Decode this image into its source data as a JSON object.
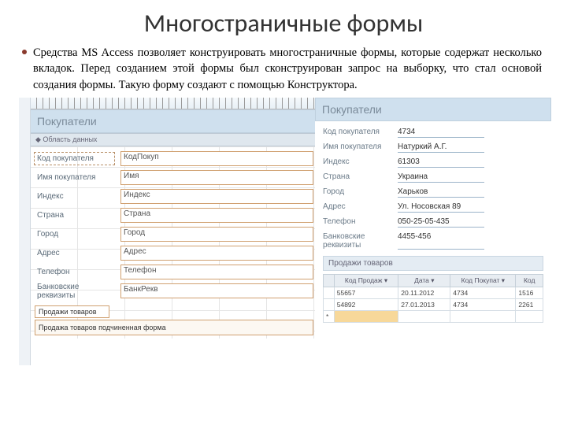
{
  "title": "Многостраничные формы",
  "bullet": "Средства MS Access позволяет конструировать многостраничные формы, которые содержат несколько вкладок. Перед созданием этой формы был сконструирован запрос на выборку, что стал основой создания формы. Такую форму создают с помощью Конструктора.",
  "left": {
    "header": "Покупатели",
    "section": "◆ Область данных",
    "rows": [
      {
        "lbl": "Код покупателя",
        "ctl": "КодПокуп"
      },
      {
        "lbl": "Имя покупателя",
        "ctl": "Имя"
      },
      {
        "lbl": "Индекс",
        "ctl": "Индекс"
      },
      {
        "lbl": "Страна",
        "ctl": "Страна"
      },
      {
        "lbl": "Город",
        "ctl": "Город"
      },
      {
        "lbl": "Адрес",
        "ctl": "Адрес"
      },
      {
        "lbl": "Телефон",
        "ctl": "Телефон"
      },
      {
        "lbl": "Банковские реквизиты",
        "ctl": "БанкРекв"
      }
    ],
    "sublbl": "Продажи товаров",
    "subtxt": "Продажа товаров подчиненная форма"
  },
  "right": {
    "header": "Покупатели",
    "rows": [
      {
        "lbl": "Код покупателя",
        "val": "4734"
      },
      {
        "lbl": "Имя покупателя",
        "val": "Натуркий А.Г."
      },
      {
        "lbl": "Индекс",
        "val": "61303"
      },
      {
        "lbl": "Страна",
        "val": "Украина"
      },
      {
        "lbl": "Город",
        "val": "Харьков"
      },
      {
        "lbl": "Адрес",
        "val": "Ул. Носовская 89"
      },
      {
        "lbl": "Телефон",
        "val": "050-25-05-435"
      },
      {
        "lbl": "Банковские реквизиты",
        "val": "4455-456"
      }
    ],
    "subhdr": "Продажи товаров",
    "thead": [
      "",
      "Код Продаж ▾",
      "Дата ▾",
      "Код Покупат ▾",
      "Код"
    ],
    "trows": [
      [
        "",
        "55657",
        "20.11.2012",
        "4734",
        "1516"
      ],
      [
        "",
        "54892",
        "27.01.2013",
        "4734",
        "2261"
      ],
      [
        "*",
        "",
        "",
        "",
        ""
      ]
    ]
  }
}
